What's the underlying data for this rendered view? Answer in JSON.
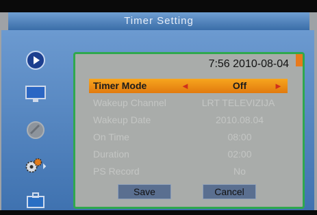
{
  "window": {
    "title": "Timer Setting"
  },
  "clock": "7:56 2010-08-04",
  "sidebar": {
    "items": [
      {
        "name": "play-icon"
      },
      {
        "name": "monitor-icon"
      },
      {
        "name": "satellite-dish-icon"
      },
      {
        "name": "settings-gears-icon"
      },
      {
        "name": "toolbox-icon"
      }
    ]
  },
  "fields": [
    {
      "label": "Timer Mode",
      "value": "Off"
    },
    {
      "label": "Wakeup Channel",
      "value": "LRT TELEVIZIJA"
    },
    {
      "label": "Wakeup Date",
      "value": "2010.08.04"
    },
    {
      "label": "On Time",
      "value": "08:00"
    },
    {
      "label": "Duration",
      "value": "02:00"
    },
    {
      "label": "PS Record",
      "value": "No"
    }
  ],
  "buttons": {
    "save": "Save",
    "cancel": "Cancel"
  },
  "colors": {
    "accent": "#f39a1c",
    "frame": "#5b8ccf",
    "panel_border": "#2fa84e"
  }
}
